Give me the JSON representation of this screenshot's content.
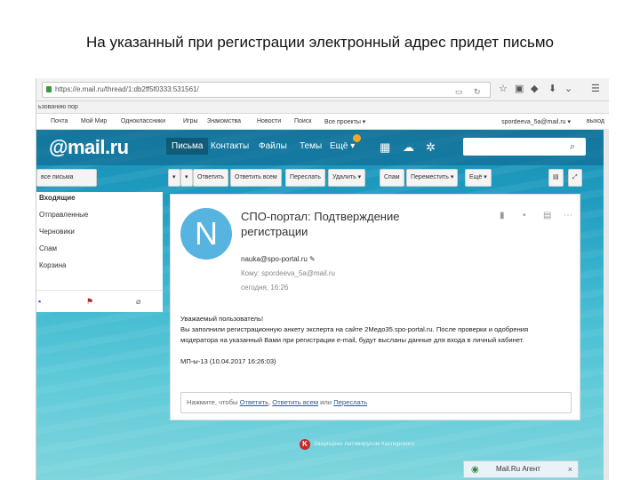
{
  "slide": {
    "title": "На указанный при регистрации электронный адрес придет письмо"
  },
  "browser": {
    "url": "https://e.mail.ru/thread/1:db2ff5f0333:531561/",
    "bookmarks_text": "ьзованию пор",
    "icons": [
      "lock-icon",
      "star-icon",
      "bookmark-icon",
      "download-icon",
      "home-icon",
      "menu-icon"
    ]
  },
  "topnav": {
    "items": [
      "Почта",
      "Мой Мир",
      "Одноклассники",
      "Игры",
      "Знакомства",
      "Новости",
      "Поиск",
      "Все проекты ▾"
    ],
    "user": "spordeeva_5a@mail.ru ▾",
    "exit": "выход"
  },
  "mail": {
    "logo": "@mail.ru",
    "tabs": [
      "Письма",
      "Контакты",
      "Файлы",
      "Темы",
      "Ещё ▾"
    ],
    "search_placeholder": "",
    "colors": {
      "avatar": "#57b3df",
      "header": "#0f628a",
      "link": "#1a5fa8"
    }
  },
  "toolbar": {
    "buttons": [
      "все письма",
      "▾",
      "▾",
      "Ответить",
      "Ответить всем",
      "Переслать",
      "Удалить ▾",
      "Спам",
      "Переместить ▾",
      "Ещё ▾"
    ]
  },
  "sidebar": {
    "folders": [
      "Входящие",
      "Отправленные",
      "Черновики",
      "Спам",
      "Корзина"
    ]
  },
  "message": {
    "avatar_letter": "N",
    "subject": "СПО-портал: Подтверждение регистрации",
    "from": "nauka@spo-portal.ru ✎",
    "to": "Кому: spordeeva_5a@mail.ru",
    "date": "сегодня, 16:26",
    "body_lines": [
      "Уважаемый пользователь!",
      "Вы заполнили регистрационную анкету эксперта на сайте 2Медо35.spo-portal.ru. После проверки и одобрения",
      "модератора на указанный Вами при регистрации e-mail, будут высланы данные для входа в личный кабинет.",
      "",
      "МП-ы-13 (10.04.2017 16:26:03)"
    ],
    "reply_prefix": "Нажмите, чтобы ",
    "reply_link1": "Ответить",
    "reply_sep": ", ",
    "reply_link2": "Ответить всем",
    "reply_mid": " или ",
    "reply_link3": "Переслать"
  },
  "footer": {
    "kaspersky": "Защищено Антивирусом Касперского",
    "agent": "Mail.Ru Агент"
  }
}
